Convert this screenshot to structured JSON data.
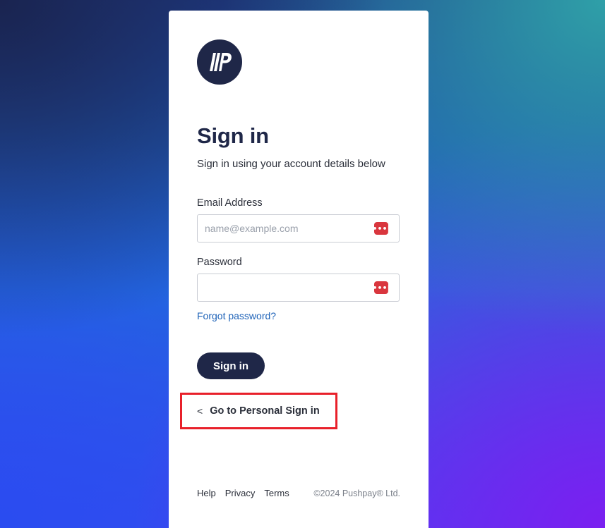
{
  "brand": {
    "logo_icon": "pushpay-logo-icon",
    "colors": {
      "navy": "#1f2748",
      "link_blue": "#1f63b8",
      "password_manager_red": "#d9363e",
      "highlight_red": "#e8202a"
    }
  },
  "form": {
    "title": "Sign in",
    "subtitle": "Sign in using your account details below",
    "email": {
      "label": "Email Address",
      "placeholder": "name@example.com",
      "value": ""
    },
    "password": {
      "label": "Password",
      "placeholder": "",
      "value": ""
    },
    "forgot_label": "Forgot password?",
    "submit_label": "Sign in"
  },
  "personal_signin": {
    "chevron_icon": "chevron-left-icon",
    "chevron_glyph": "<",
    "label": "Go to Personal Sign in"
  },
  "password_manager": {
    "icon": "password-manager-icon",
    "glyph": "•••|"
  },
  "footer": {
    "links": [
      "Help",
      "Privacy",
      "Terms"
    ],
    "copyright": "©2024 Pushpay® Ltd."
  }
}
